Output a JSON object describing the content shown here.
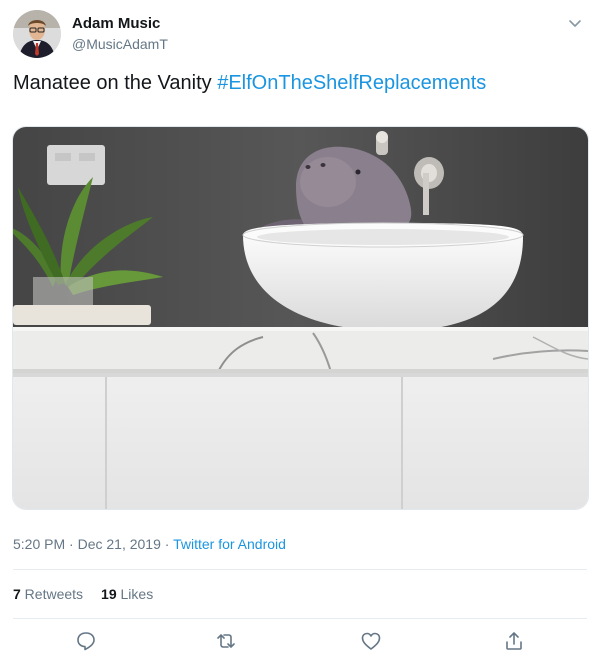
{
  "author": {
    "name": "Adam Music",
    "handle": "@MusicAdamT"
  },
  "tweet": {
    "text": "Manatee on the Vanity ",
    "hashtag": "#ElfOnTheShelfReplacements"
  },
  "meta": {
    "time": "5:20 PM",
    "dot1": " · ",
    "date": "Dec 21, 2019",
    "dot2": " · ",
    "app": "Twitter for Android"
  },
  "stats": {
    "retweets_count": "7",
    "retweets_label": " Retweets",
    "likes_count": "19",
    "likes_label": " Likes"
  },
  "icons": {
    "reply": "reply-icon",
    "retweet": "retweet-icon",
    "like": "heart-icon",
    "share": "share-icon",
    "more": "chevron-down-icon"
  },
  "colors": {
    "link": "#1b95e0",
    "secondary": "#657786",
    "text": "#14171a",
    "divider": "#e6ecf0"
  }
}
